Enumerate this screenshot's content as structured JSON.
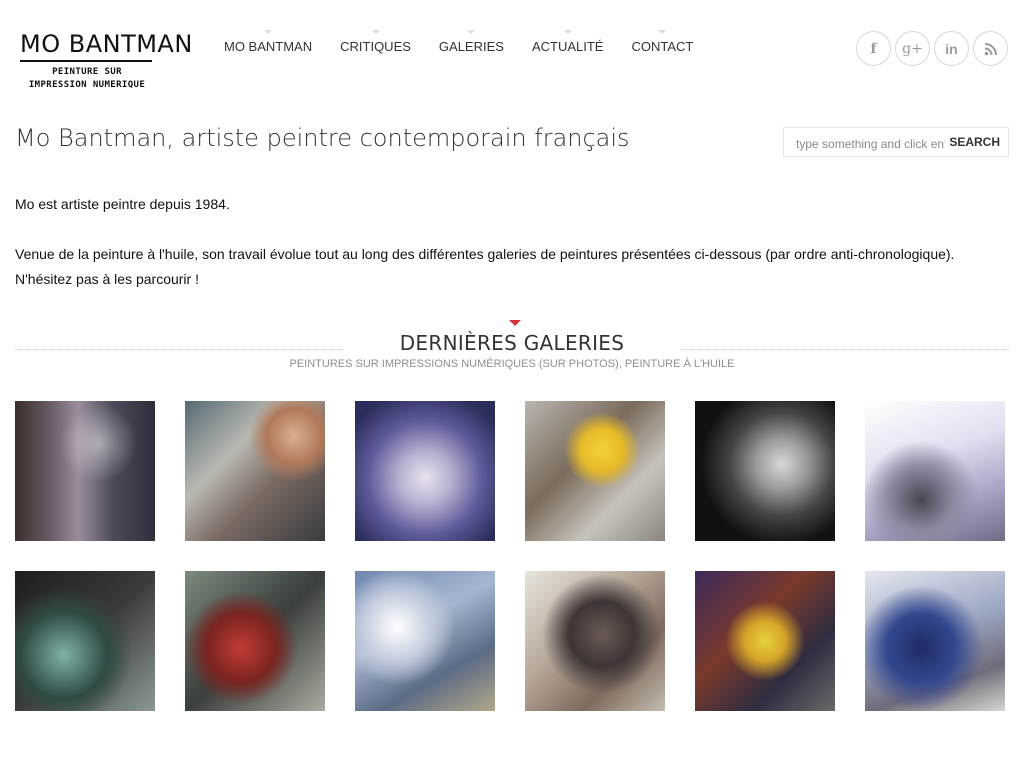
{
  "logo": {
    "title": "MO BANTMAN",
    "subtitle_line1": "PEINTURE SUR",
    "subtitle_line2": "IMPRESSION NUMERIQUE"
  },
  "nav": {
    "items": [
      {
        "label": "MO BANTMAN"
      },
      {
        "label": "CRITIQUES"
      },
      {
        "label": "GALERIES"
      },
      {
        "label": "ACTUALITÉ"
      },
      {
        "label": "CONTACT"
      }
    ]
  },
  "social": {
    "facebook": "f",
    "googleplus": "g+",
    "linkedin": "in",
    "rss": "rss-icon"
  },
  "search": {
    "placeholder": "type something and click enter",
    "button_label": "SEARCH"
  },
  "page": {
    "title": "Mo Bantman, artiste peintre contemporain français",
    "intro_line1": "Mo est artiste peintre depuis 1984.",
    "intro_line2": "Venue de la peinture à l'huile, son travail évolue tout au long des différentes galeries de peintures présentées ci-dessous (par ordre anti-chronologique).",
    "intro_line3": "N'hésitez pas à les parcourir !"
  },
  "section": {
    "title": "DERNIÈRES GALERIES",
    "subtitle": "PEINTURES SUR IMPRESSIONS NUMÉRIQUES (SUR PHOTOS), PEINTURE À L'HUILE"
  },
  "colors": {
    "accent": "#d0343b",
    "text": "#222222",
    "muted": "#8f8f8f"
  }
}
